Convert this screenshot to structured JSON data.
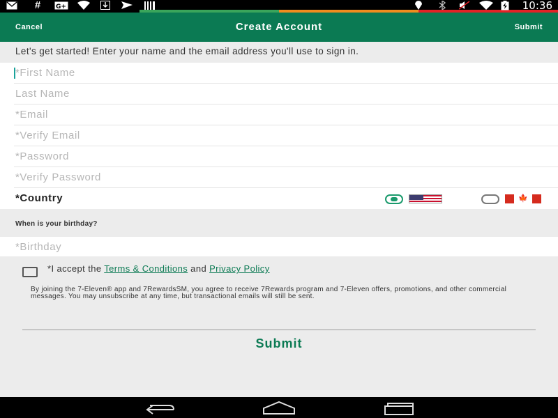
{
  "status_bar": {
    "time": "10:36",
    "left_icons": [
      "mail-icon",
      "hash-icon",
      "google-plus-icon",
      "wifi-icon",
      "download-icon",
      "send-icon",
      "barcode-icon"
    ],
    "right_icons": [
      "location-icon",
      "bluetooth-icon",
      "mute-icon",
      "wifi-icon",
      "battery-icon"
    ],
    "stripe_colors": [
      "#3aa55b",
      "#f08c1e",
      "#e32226"
    ]
  },
  "app_bar": {
    "cancel_label": "Cancel",
    "title": "Create Account",
    "submit_label": "Submit",
    "color": "#0b7a53"
  },
  "intro": "Let's get started! Enter your name and the email address you'll use to sign in.",
  "fields": {
    "first_name": "*First Name",
    "last_name": "Last Name",
    "email": "*Email",
    "verify_email": "*Verify Email",
    "password": "*Password",
    "verify_password": "*Verify Password"
  },
  "country": {
    "label": "*Country",
    "selected": "US",
    "options": [
      "US",
      "CA"
    ],
    "flag_icons": [
      "us-flag-icon",
      "canada-flag-icon"
    ]
  },
  "birthday": {
    "question": "When is your birthday?",
    "placeholder": "*Birthday"
  },
  "terms": {
    "prefix": "*I accept the ",
    "terms_link": "Terms & Conditions",
    "and": " and ",
    "privacy_link": "Privacy Policy",
    "checked": false
  },
  "disclaimer": "By joining the 7-Eleven® app and 7RewardsSM, you agree to receive 7Rewards program and 7-Eleven offers, promotions, and other commercial messages. You may unsubscribe at any time, but transactional emails will still be sent.",
  "submit_button": "Submit",
  "nav_bar": {
    "icons": [
      "back-icon",
      "home-icon",
      "recents-icon"
    ]
  }
}
